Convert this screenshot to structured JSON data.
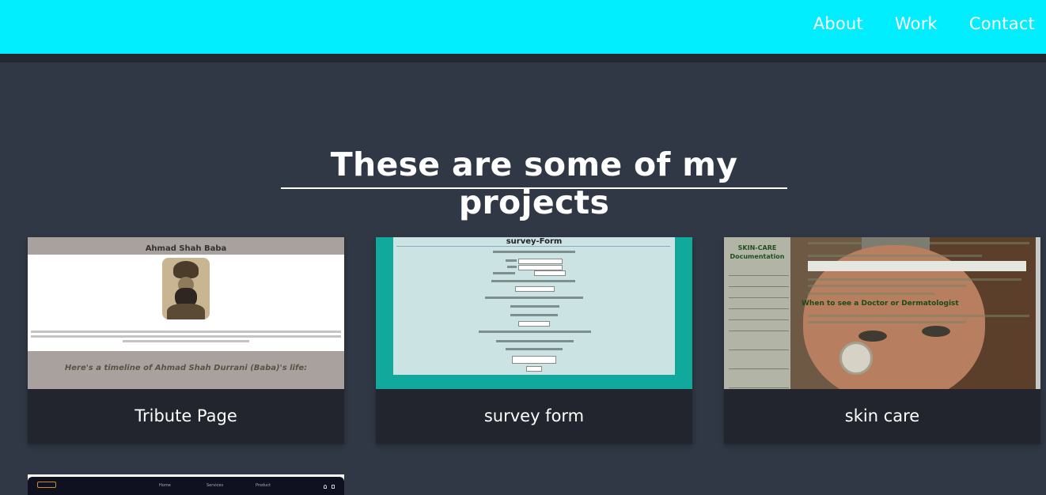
{
  "nav": {
    "items": [
      {
        "label": "About"
      },
      {
        "label": "Work"
      },
      {
        "label": "Contact"
      }
    ]
  },
  "projects": {
    "title": "These are some of my projects",
    "cards": [
      {
        "label": "Tribute Page",
        "preview_heading": "Ahmad Shah Baba",
        "preview_subheading": "Here's a timeline of Ahmad Shah Durrani (Baba)'s life:"
      },
      {
        "label": "survey form",
        "preview_heading": "survey-Form"
      },
      {
        "label": "skin care",
        "preview_heading": "SKIN-CARE Documentation",
        "preview_subheading": "When to see a Doctor or Dermatologist"
      }
    ],
    "partial_card": {
      "nav": [
        "Home",
        "Services",
        "Product"
      ]
    }
  },
  "colors": {
    "navbar": "#00eeff",
    "background": "#303846",
    "card_label_bg": "#22252e"
  }
}
